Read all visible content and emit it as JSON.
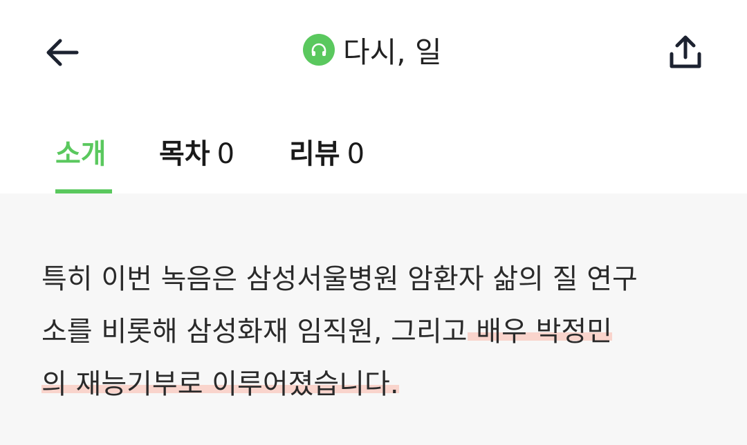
{
  "header": {
    "back_icon": "arrow-left-icon",
    "audio_icon": "headphones-icon",
    "title": "다시, 일",
    "share_icon": "share-upload-icon",
    "accent_color": "#5ac85e"
  },
  "tabs": [
    {
      "label": "소개",
      "count": "",
      "active": true
    },
    {
      "label": "목차",
      "count": "0",
      "active": false
    },
    {
      "label": "리뷰",
      "count": "0",
      "active": false
    }
  ],
  "description": {
    "line1": "특히 이번 녹음은 삼성서울병원 암환자 삶의 질 연구",
    "line2_plain": "소를 비롯해 삼성화재 임직원, 그리고",
    "line2_highlight": " 배우 박정민",
    "line3_highlight": "의 재능기부로 이루어졌습니다.",
    "highlight_color": "#f9d4cc"
  }
}
